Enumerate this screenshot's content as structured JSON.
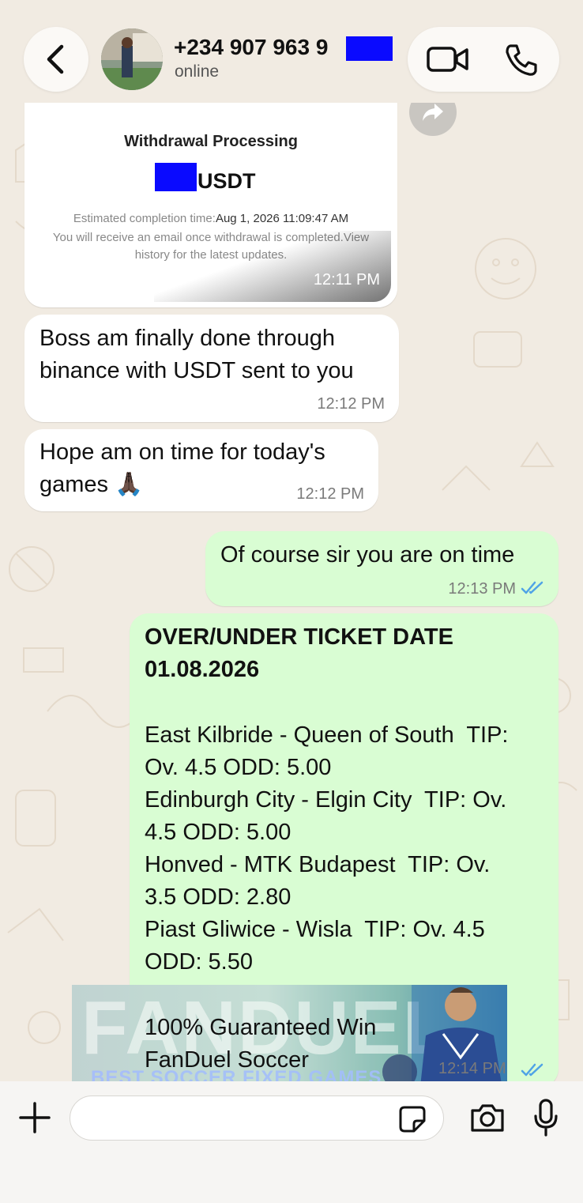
{
  "header": {
    "contact_name": "+234 907 963 9",
    "status": "online"
  },
  "messages": [
    {
      "type": "image",
      "direction": "incoming",
      "image": {
        "title": "Withdrawal Processing",
        "amount_suffix": "USDT",
        "estimated_label": "Estimated completion time:",
        "estimated_value": "Aug 1, 2026 11:09:47 AM",
        "info": "You will receive an email once withdrawal is completed.View history for the latest updates."
      },
      "time": "12:11 PM"
    },
    {
      "type": "text",
      "direction": "incoming",
      "text": "Boss am finally done through\nbinance with USDT sent to you",
      "time": "12:12 PM"
    },
    {
      "type": "text",
      "direction": "incoming",
      "text": "Hope am on time for today's\ngames 🙏🏿",
      "time": "12:12 PM"
    },
    {
      "type": "text",
      "direction": "outgoing",
      "text": "Of course sir you are on time",
      "time": "12:13 PM",
      "status": "read"
    },
    {
      "type": "text",
      "direction": "outgoing",
      "title": "OVER/UNDER TICKET DATE\n01.08.2026",
      "body": "East Kilbride - Queen of South  TIP:\nOv. 4.5 ODD: 5.00\nEdinburgh City - Elgin City  TIP: Ov.\n4.5 ODD: 5.00\nHonved - MTK Budapest  TIP: Ov.\n3.5 ODD: 2.80\nPiast Gliwice - Wisla  TIP: Ov. 4.5\nODD: 5.50",
      "footer": "100% Guaranteed Win\nFanDuel Soccer",
      "time": "12:14 PM",
      "status": "read"
    }
  ],
  "ad_overlay": {
    "logo": "FANDUEL",
    "tagline": "BEST SOCCER FIXED GAMES"
  },
  "input": {
    "placeholder": "",
    "value": ""
  },
  "colors": {
    "incoming_bubble": "#ffffff",
    "outgoing_bubble": "#d9fdd3",
    "read_ticks": "#4fa3e6",
    "redaction": "#0a0aff"
  },
  "icons": [
    "back-chevron-icon",
    "video-call-icon",
    "phone-icon",
    "forward-icon",
    "plus-icon",
    "sticker-icon",
    "camera-icon",
    "microphone-icon",
    "read-ticks-icon"
  ]
}
